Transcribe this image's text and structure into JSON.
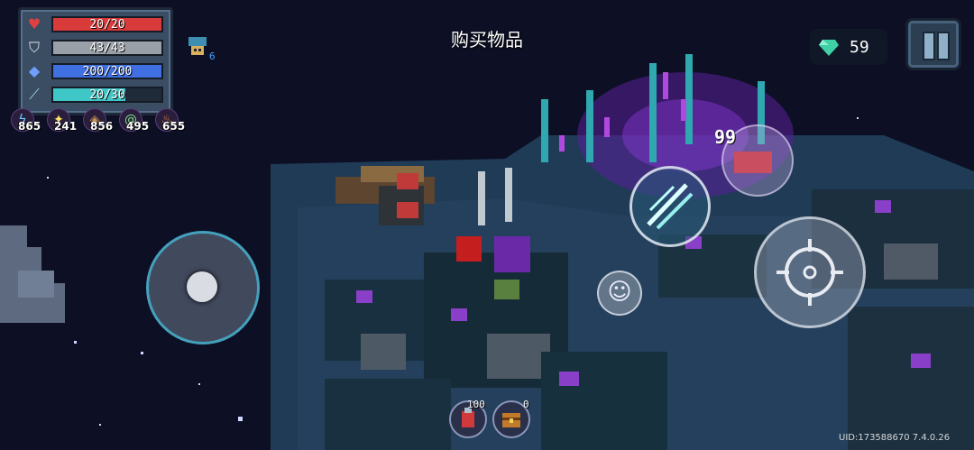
{
  "hud": {
    "stats": [
      {
        "id": "health",
        "icon": "heart-icon",
        "text": "20/20",
        "ratio": 1.0,
        "color": "#d93a3a"
      },
      {
        "id": "armor",
        "icon": "shield-icon",
        "text": "43/43",
        "ratio": 1.0,
        "color": "#9aa0a8"
      },
      {
        "id": "energy",
        "icon": "diamond-icon",
        "text": "200/200",
        "ratio": 1.0,
        "color": "#3f6fe0"
      },
      {
        "id": "charge",
        "icon": "sword-icon",
        "text": "20/30",
        "ratio": 0.6667,
        "color": "#3fc6c6"
      }
    ],
    "buff_count": "6",
    "resources": [
      {
        "icon": "lightning-icon",
        "value": "865",
        "color": "#6ad0ff"
      },
      {
        "icon": "star-icon",
        "value": "241",
        "color": "#ffe46a"
      },
      {
        "icon": "rune-icon",
        "value": "856",
        "color": "#c69050"
      },
      {
        "icon": "swirl-icon",
        "value": "495",
        "color": "#7be08a"
      },
      {
        "icon": "flame-icon",
        "value": "655",
        "color": "#ff9a3a"
      }
    ]
  },
  "title": "购买物品",
  "gems": {
    "value": "59",
    "color": "#3fd0a8"
  },
  "controls": {
    "weapon_cost": "99",
    "items": [
      {
        "icon": "potion-icon",
        "count": "100"
      },
      {
        "icon": "chest-icon",
        "count": "0"
      }
    ]
  },
  "footer": {
    "uid": "UID:173588670 7.4.0.26"
  }
}
